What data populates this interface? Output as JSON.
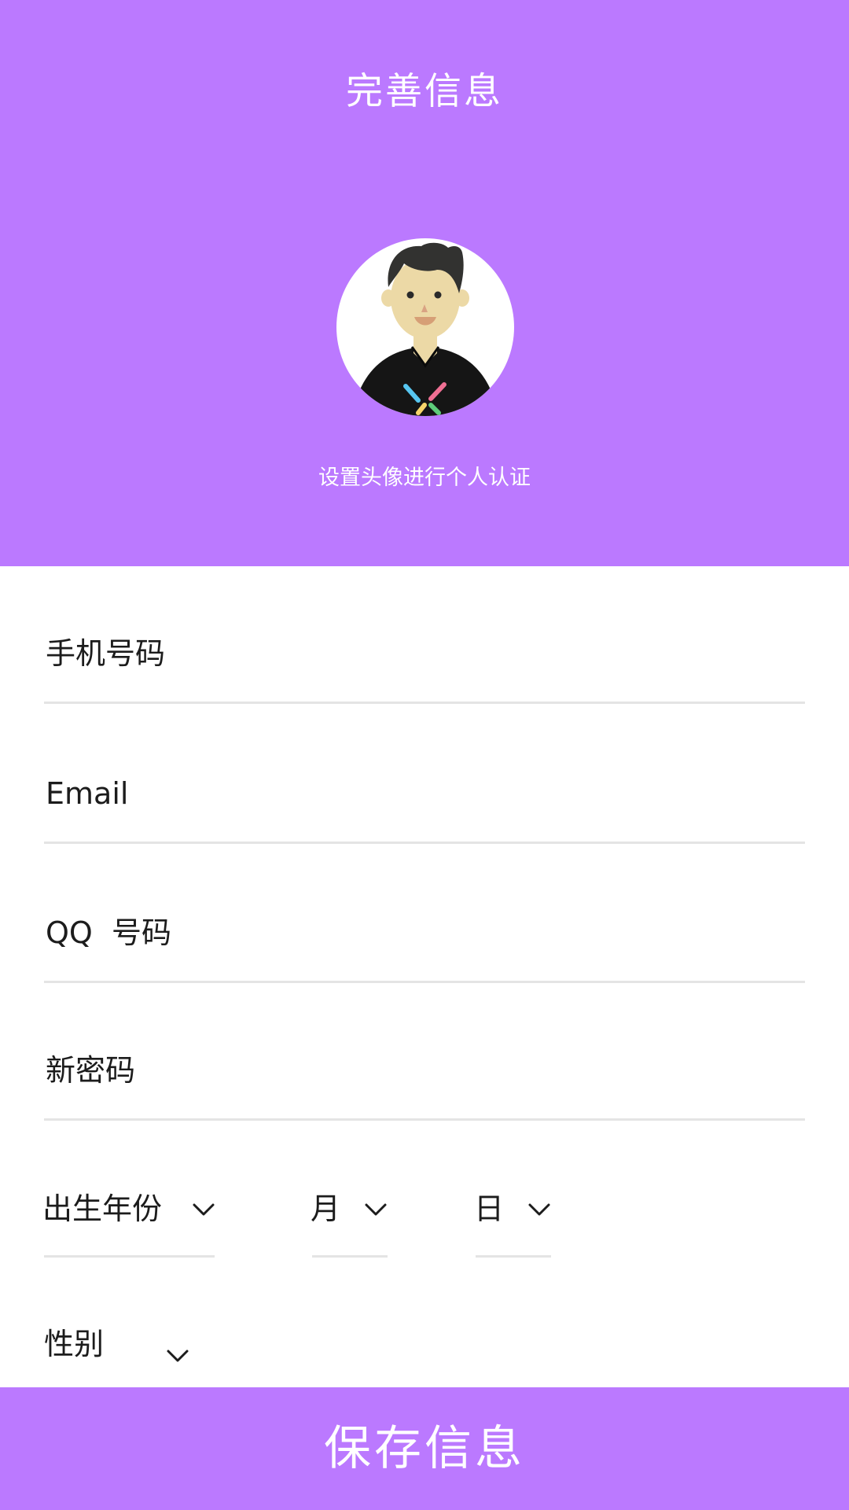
{
  "header": {
    "title": "完善信息",
    "avatar_hint": "设置头像进行个人认证",
    "background_color": "#bb79ff"
  },
  "avatar": {
    "icon": "user-avatar-illustration"
  },
  "form": {
    "phone_placeholder": "手机号码",
    "email_placeholder": "Email",
    "qq_placeholder": "QQ  号码",
    "password_placeholder": "新密码",
    "birth_year_label": "出生年份",
    "birth_month_label": "月",
    "birth_day_label": "日",
    "gender_label": "性别",
    "dropdown_icon": "chevron-down-icon"
  },
  "footer": {
    "save_label": "保存信息",
    "background_color": "#bb79ff"
  }
}
